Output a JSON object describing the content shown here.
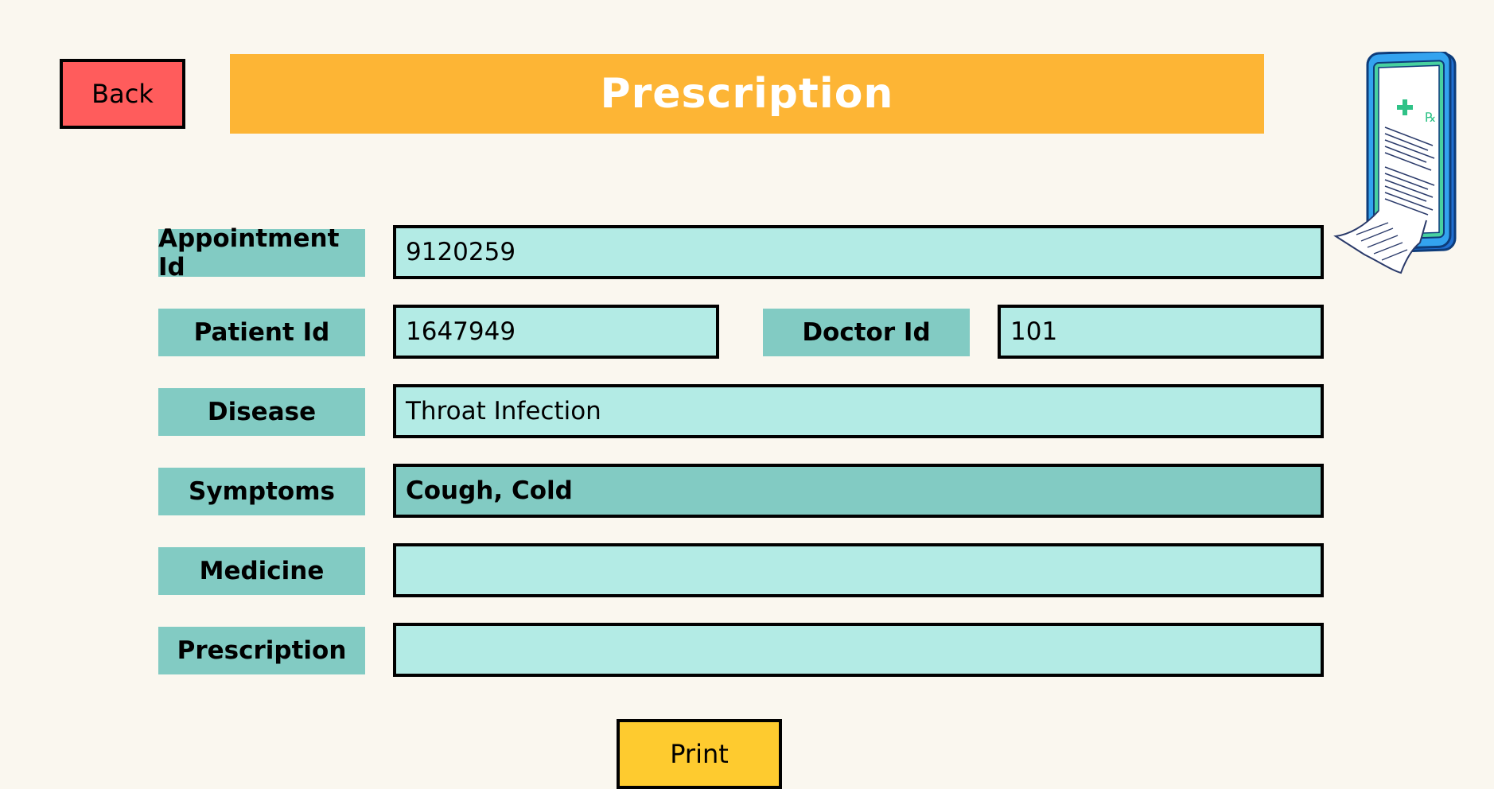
{
  "header": {
    "back_label": "Back",
    "title": "Prescription"
  },
  "illustration": {
    "icon": "prescription-phone-illustration"
  },
  "form": {
    "appointment_id": {
      "label": "Appointment Id",
      "value": "9120259"
    },
    "patient_id": {
      "label": "Patient Id",
      "value": "1647949"
    },
    "doctor_id": {
      "label": "Doctor Id",
      "value": "101"
    },
    "disease": {
      "label": "Disease",
      "value": "Throat Infection"
    },
    "symptoms": {
      "label": "Symptoms",
      "value": "Cough, Cold"
    },
    "medicine": {
      "label": "Medicine",
      "value": ""
    },
    "prescription": {
      "label": "Prescription",
      "value": ""
    }
  },
  "actions": {
    "print_label": "Print"
  },
  "colors": {
    "background": "#faf7ef",
    "back_button": "#ff5c5c",
    "title_bar": "#fdb535",
    "label_bg": "#82cbc3",
    "field_bg": "#b3ebe5",
    "print_button": "#fecb2f"
  }
}
